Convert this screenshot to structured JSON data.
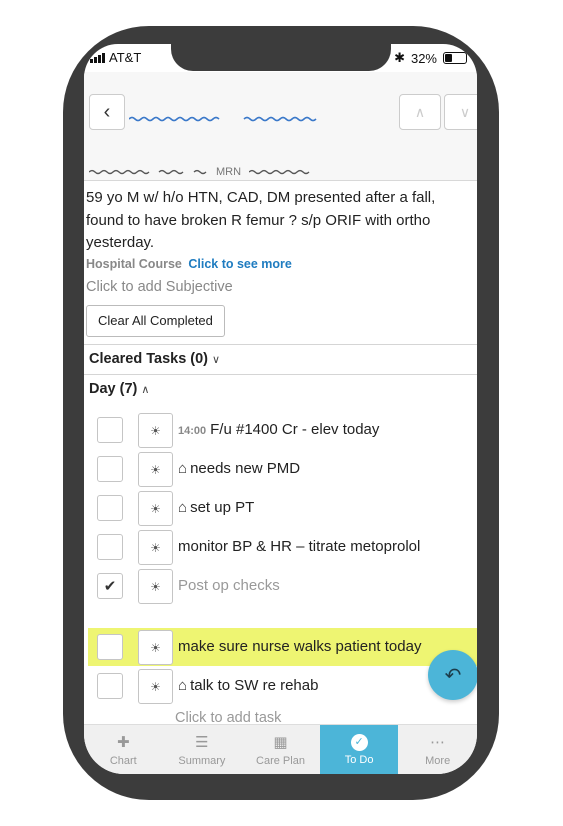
{
  "status_bar": {
    "carrier": "AT&T",
    "battery": "32%",
    "bluetooth_icon": "bluetooth-icon"
  },
  "header": {
    "mrn_label": "MRN"
  },
  "summary": "59 yo M w/ h/o HTN, CAD, DM presented after a fall, found to have broken R femur ? s/p ORIF with ortho yesterday.",
  "hospital_course": {
    "label": "Hospital Course",
    "link": "Click to see more"
  },
  "subjective_placeholder": "Click to add Subjective",
  "clear_button": "Clear All Completed",
  "cleared_tasks": {
    "label": "Cleared Tasks (0)"
  },
  "day_section": {
    "label": "Day (7)"
  },
  "tasks": [
    {
      "time": "14:00",
      "text": "F/u #1400 Cr - elev today",
      "checked": false,
      "home_icon": false,
      "highlight": false
    },
    {
      "time": "",
      "text": "needs new PMD",
      "checked": false,
      "home_icon": true,
      "highlight": false
    },
    {
      "time": "",
      "text": "set up PT",
      "checked": false,
      "home_icon": true,
      "highlight": false
    },
    {
      "time": "",
      "text": "monitor BP & HR – titrate metoprolol",
      "checked": false,
      "home_icon": false,
      "highlight": false
    },
    {
      "time": "",
      "text": "Post op checks",
      "checked": true,
      "home_icon": false,
      "highlight": false
    },
    {
      "time": "",
      "text": "make sure nurse walks patient today",
      "checked": false,
      "home_icon": false,
      "highlight": true
    },
    {
      "time": "",
      "text": "talk to SW re rehab",
      "checked": false,
      "home_icon": true,
      "highlight": false
    }
  ],
  "add_task_placeholder": "Click to add task",
  "tabs": [
    {
      "label": "Chart",
      "icon": "briefcase-medical-icon",
      "active": false
    },
    {
      "label": "Summary",
      "icon": "document-icon",
      "active": false
    },
    {
      "label": "Care Plan",
      "icon": "calendar-icon",
      "active": false
    },
    {
      "label": "To Do",
      "icon": "check-circle-icon",
      "active": true
    },
    {
      "label": "More",
      "icon": "ellipsis-icon",
      "active": false
    }
  ],
  "colors": {
    "accent": "#4cb5d8",
    "highlight": "#eef572",
    "link": "#1f7cc0",
    "phone_frame": "#3c3c3c"
  }
}
